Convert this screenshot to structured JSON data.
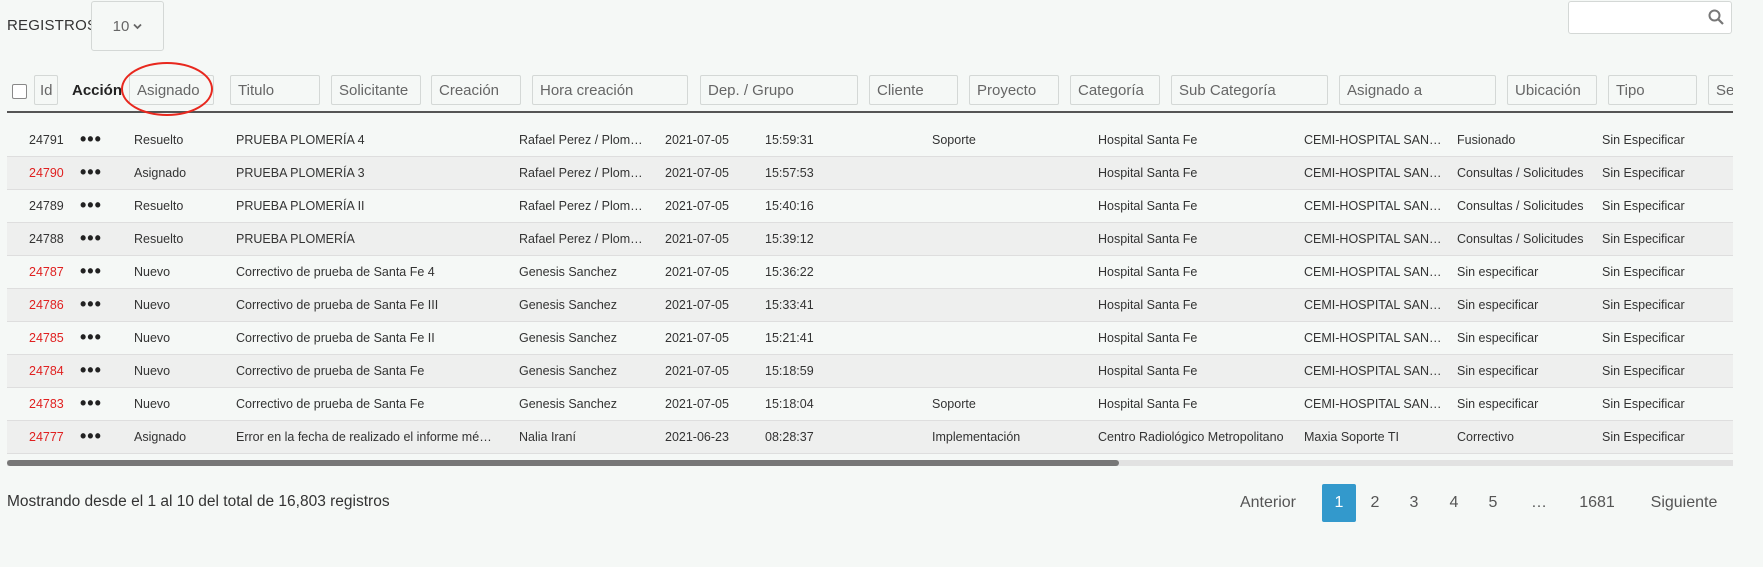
{
  "top": {
    "registros_label": "REGISTROS",
    "page_size": "10",
    "search_value": ""
  },
  "filters": [
    "Id",
    "Asignado",
    "Titulo",
    "Solicitante",
    "Creación",
    "Hora creación",
    "Dep. / Grupo",
    "Cliente",
    "Proyecto",
    "Categoría",
    "Sub Categoría",
    "Asignado a",
    "Ubicación",
    "Tipo",
    "Se"
  ],
  "accion_label": "Acción",
  "rows": [
    {
      "id": "24791",
      "red": false,
      "estado": "Resuelto",
      "titulo": "PRUEBA PLOMERÍA 4",
      "solicitante": "Rafael Perez / Plomeria",
      "fecha": "2021-07-05",
      "hora": "15:59:31",
      "proyecto": "Soporte",
      "ubicacion": "Hospital Santa Fe",
      "cliente2": "CEMI-HOSPITAL SANTA FE",
      "categoria": "Fusionado",
      "tipo": "Sin Especificar"
    },
    {
      "id": "24790",
      "red": true,
      "estado": "Asignado",
      "titulo": "PRUEBA PLOMERÍA 3",
      "solicitante": "Rafael Perez / Plomeria",
      "fecha": "2021-07-05",
      "hora": "15:57:53",
      "proyecto": "",
      "ubicacion": "Hospital Santa Fe",
      "cliente2": "CEMI-HOSPITAL SANTA FE",
      "categoria": "Consultas / Solicitudes",
      "tipo": "Sin Especificar"
    },
    {
      "id": "24789",
      "red": false,
      "estado": "Resuelto",
      "titulo": "PRUEBA PLOMERÍA II",
      "solicitante": "Rafael Perez / Plomeria",
      "fecha": "2021-07-05",
      "hora": "15:40:16",
      "proyecto": "",
      "ubicacion": "Hospital Santa Fe",
      "cliente2": "CEMI-HOSPITAL SANTA FE",
      "categoria": "Consultas / Solicitudes",
      "tipo": "Sin Especificar"
    },
    {
      "id": "24788",
      "red": false,
      "estado": "Resuelto",
      "titulo": "PRUEBA PLOMERÍA",
      "solicitante": "Rafael Perez / Plomeria",
      "fecha": "2021-07-05",
      "hora": "15:39:12",
      "proyecto": "",
      "ubicacion": "Hospital Santa Fe",
      "cliente2": "CEMI-HOSPITAL SANTA FE",
      "categoria": "Consultas / Solicitudes",
      "tipo": "Sin Especificar"
    },
    {
      "id": "24787",
      "red": true,
      "estado": "Nuevo",
      "titulo": "Correctivo de prueba de Santa Fe 4",
      "solicitante": "Genesis Sanchez",
      "fecha": "2021-07-05",
      "hora": "15:36:22",
      "proyecto": "",
      "ubicacion": "Hospital Santa Fe",
      "cliente2": "CEMI-HOSPITAL SANTA FE",
      "categoria": "Sin especificar",
      "tipo": "Sin Especificar"
    },
    {
      "id": "24786",
      "red": true,
      "estado": "Nuevo",
      "titulo": "Correctivo de prueba de Santa Fe III",
      "solicitante": "Genesis Sanchez",
      "fecha": "2021-07-05",
      "hora": "15:33:41",
      "proyecto": "",
      "ubicacion": "Hospital Santa Fe",
      "cliente2": "CEMI-HOSPITAL SANTA FE",
      "categoria": "Sin especificar",
      "tipo": "Sin Especificar"
    },
    {
      "id": "24785",
      "red": true,
      "estado": "Nuevo",
      "titulo": "Correctivo de prueba de Santa Fe II",
      "solicitante": "Genesis Sanchez",
      "fecha": "2021-07-05",
      "hora": "15:21:41",
      "proyecto": "",
      "ubicacion": "Hospital Santa Fe",
      "cliente2": "CEMI-HOSPITAL SANTA FE",
      "categoria": "Sin especificar",
      "tipo": "Sin Especificar"
    },
    {
      "id": "24784",
      "red": true,
      "estado": "Nuevo",
      "titulo": "Correctivo de prueba de Santa Fe",
      "solicitante": "Genesis Sanchez",
      "fecha": "2021-07-05",
      "hora": "15:18:59",
      "proyecto": "",
      "ubicacion": "Hospital Santa Fe",
      "cliente2": "CEMI-HOSPITAL SANTA FE",
      "categoria": "Sin especificar",
      "tipo": "Sin Especificar"
    },
    {
      "id": "24783",
      "red": true,
      "estado": "Nuevo",
      "titulo": "Correctivo de prueba de Santa Fe",
      "solicitante": "Genesis Sanchez",
      "fecha": "2021-07-05",
      "hora": "15:18:04",
      "proyecto": "Soporte",
      "ubicacion": "Hospital Santa Fe",
      "cliente2": "CEMI-HOSPITAL SANTA FE",
      "categoria": "Sin especificar",
      "tipo": "Sin Especificar"
    },
    {
      "id": "24777",
      "red": true,
      "estado": "Asignado",
      "titulo": "Error en la fecha de realizado el informe méd ...",
      "solicitante": "Nalia Iraní",
      "fecha": "2021-06-23",
      "hora": "08:28:37",
      "proyecto": "Implementación",
      "ubicacion": "Centro Radiológico Metropolitano",
      "cliente2": "Maxia Soporte TI",
      "categoria": "Correctivo",
      "tipo": "Sin Especificar"
    }
  ],
  "footer": {
    "info": "Mostrando desde el 1 al 10 del total de 16,803 registros",
    "prev": "Anterior",
    "pages": [
      "1",
      "2",
      "3",
      "4",
      "5",
      "…",
      "1681"
    ],
    "next": "Siguiente",
    "active_page": "1"
  },
  "colors": {
    "accent": "#3399cc",
    "id_red": "#e02020",
    "annotation": "#e8281e"
  }
}
